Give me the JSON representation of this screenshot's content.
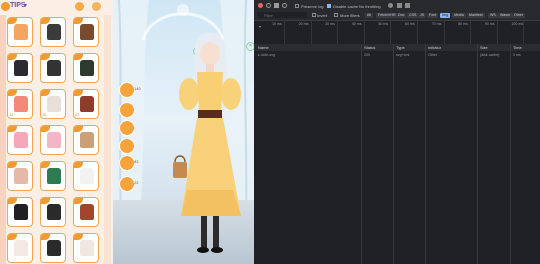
{
  "wardrobe": {
    "tips_label": "TIPS",
    "items": [
      {
        "color": "#f3a45e",
        "tag": ""
      },
      {
        "color": "#3b3b3b",
        "tag": ""
      },
      {
        "color": "#7a4a2c",
        "tag": ""
      },
      {
        "color": "#2a2a30",
        "tag": ""
      },
      {
        "color": "#333333",
        "tag": ""
      },
      {
        "color": "#2f3a2f",
        "tag": ""
      },
      {
        "color": "#f28a7a",
        "tag": "12"
      },
      {
        "color": "#e8e0d8",
        "tag": "15"
      },
      {
        "color": "#8e3b2a",
        "tag": "27"
      },
      {
        "color": "#f6a7b8",
        "tag": ""
      },
      {
        "color": "#f2b6c7",
        "tag": ""
      },
      {
        "color": "#c9a07a",
        "tag": ""
      },
      {
        "color": "#e6b8a8",
        "tag": ""
      },
      {
        "color": "#2e7a52",
        "tag": ""
      },
      {
        "color": "#f2f2f2",
        "tag": ""
      },
      {
        "color": "#1f1f24",
        "tag": ""
      },
      {
        "color": "#2a2a2a",
        "tag": ""
      },
      {
        "color": "#a3442e",
        "tag": ""
      },
      {
        "color": "#f2e9e4",
        "tag": ""
      },
      {
        "color": "#2a2a2a",
        "tag": ""
      },
      {
        "color": "#efe7e0",
        "tag": ""
      }
    ]
  },
  "scene": {
    "side_counts": [
      "140",
      "83",
      "22"
    ]
  },
  "devtools": {
    "toolbar": {
      "preserve_log": "Preserve log",
      "disable_cache": "Disable cache",
      "throttling": "No throttling"
    },
    "filter": {
      "placeholder": "Filter",
      "invert": "Invert",
      "more_filters": "More filters"
    },
    "filter_types": [
      "All",
      "Fetch/XHR",
      "Doc",
      "CSS",
      "JS",
      "Font",
      "Img",
      "Media",
      "Manifest",
      "WS",
      "Wasm",
      "Other"
    ],
    "active_type": "Img",
    "timeline_labels": [
      "10 ms",
      "20 ms",
      "30 ms",
      "40 ms",
      "50 ms",
      "60 ms",
      "70 ms",
      "80 ms",
      "90 ms",
      "100 ms"
    ],
    "columns": [
      "Name",
      "Status",
      "Type",
      "Initiator",
      "Size",
      "Time"
    ],
    "rows": [
      {
        "name": "cloth.svg",
        "status": "200",
        "type": "svg+xml",
        "initiator": "Other",
        "size": "(disk cache)",
        "time": "0 ms"
      }
    ]
  }
}
